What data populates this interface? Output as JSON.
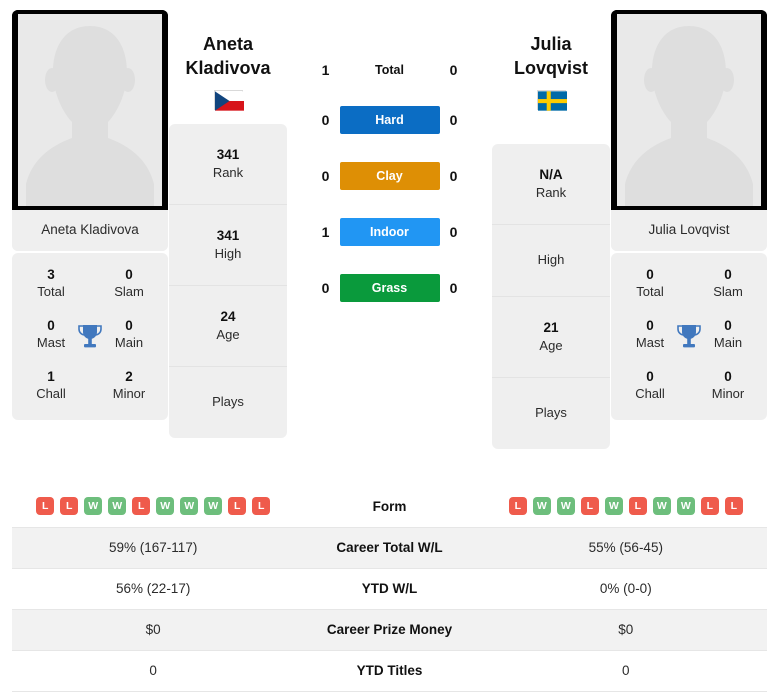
{
  "colors": {
    "hard": "#0b6dc4",
    "clay": "#de8f05",
    "indoor": "#2196f3",
    "grass": "#0a9a3c",
    "win": "#6dbe7c",
    "loss": "#ef5b4c",
    "trophy": "#4178be",
    "card_bg": "#efefef",
    "row_alt": "#f2f2f2"
  },
  "players": {
    "left": {
      "first_name": "Aneta",
      "last_name": "Kladivova",
      "full_name": "Aneta Kladivova",
      "photo_caption": "Aneta Kladivova",
      "country": "Czech Republic",
      "flag_icon": "czech-republic-flag",
      "info": [
        {
          "value": "341",
          "label": "Rank"
        },
        {
          "value": "341",
          "label": "High"
        },
        {
          "value": "24",
          "label": "Age"
        },
        {
          "value": "",
          "label": "Plays"
        }
      ],
      "titles": [
        {
          "value": "3",
          "label": "Total"
        },
        {
          "value": "0",
          "label": "Slam"
        },
        {
          "value": "0",
          "label": "Mast"
        },
        {
          "value": "0",
          "label": "Main"
        },
        {
          "value": "1",
          "label": "Chall"
        },
        {
          "value": "2",
          "label": "Minor"
        }
      ],
      "form": [
        "L",
        "L",
        "W",
        "W",
        "L",
        "W",
        "W",
        "W",
        "L",
        "L"
      ],
      "career_total_wl": "59% (167-117)",
      "ytd_wl": "56% (22-17)",
      "career_prize_money": "$0",
      "ytd_titles": "0"
    },
    "right": {
      "first_name": "Julia",
      "last_name": "Lovqvist",
      "full_name": "Julia Lovqvist",
      "photo_caption": "Julia Lovqvist",
      "country": "Sweden",
      "flag_icon": "sweden-flag",
      "info": [
        {
          "value": "N/A",
          "label": "Rank"
        },
        {
          "value": "",
          "label": "High"
        },
        {
          "value": "21",
          "label": "Age"
        },
        {
          "value": "",
          "label": "Plays"
        }
      ],
      "titles": [
        {
          "value": "0",
          "label": "Total"
        },
        {
          "value": "0",
          "label": "Slam"
        },
        {
          "value": "0",
          "label": "Mast"
        },
        {
          "value": "0",
          "label": "Main"
        },
        {
          "value": "0",
          "label": "Chall"
        },
        {
          "value": "0",
          "label": "Minor"
        }
      ],
      "form": [
        "L",
        "W",
        "W",
        "L",
        "W",
        "L",
        "W",
        "W",
        "L",
        "L"
      ],
      "career_total_wl": "55% (56-45)",
      "ytd_wl": "0% (0-0)",
      "career_prize_money": "$0",
      "ytd_titles": "0"
    }
  },
  "head_to_head": [
    {
      "label": "Total",
      "left": "1",
      "right": "0",
      "style": "plain",
      "color": ""
    },
    {
      "label": "Hard",
      "left": "0",
      "right": "0",
      "style": "badge",
      "color": "#0b6dc4"
    },
    {
      "label": "Clay",
      "left": "0",
      "right": "0",
      "style": "badge",
      "color": "#de8f05"
    },
    {
      "label": "Indoor",
      "left": "1",
      "right": "0",
      "style": "badge",
      "color": "#2196f3"
    },
    {
      "label": "Grass",
      "left": "0",
      "right": "0",
      "style": "badge",
      "color": "#0a9a3c"
    }
  ],
  "stats_rows": [
    {
      "label": "Form",
      "left": "",
      "right": "",
      "type": "form"
    },
    {
      "label": "Career Total W/L",
      "left": "59% (167-117)",
      "right": "55% (56-45)",
      "type": "text"
    },
    {
      "label": "YTD W/L",
      "left": "56% (22-17)",
      "right": "0% (0-0)",
      "type": "text"
    },
    {
      "label": "Career Prize Money",
      "left": "$0",
      "right": "$0",
      "type": "text"
    },
    {
      "label": "YTD Titles",
      "left": "0",
      "right": "0",
      "type": "text"
    }
  ]
}
